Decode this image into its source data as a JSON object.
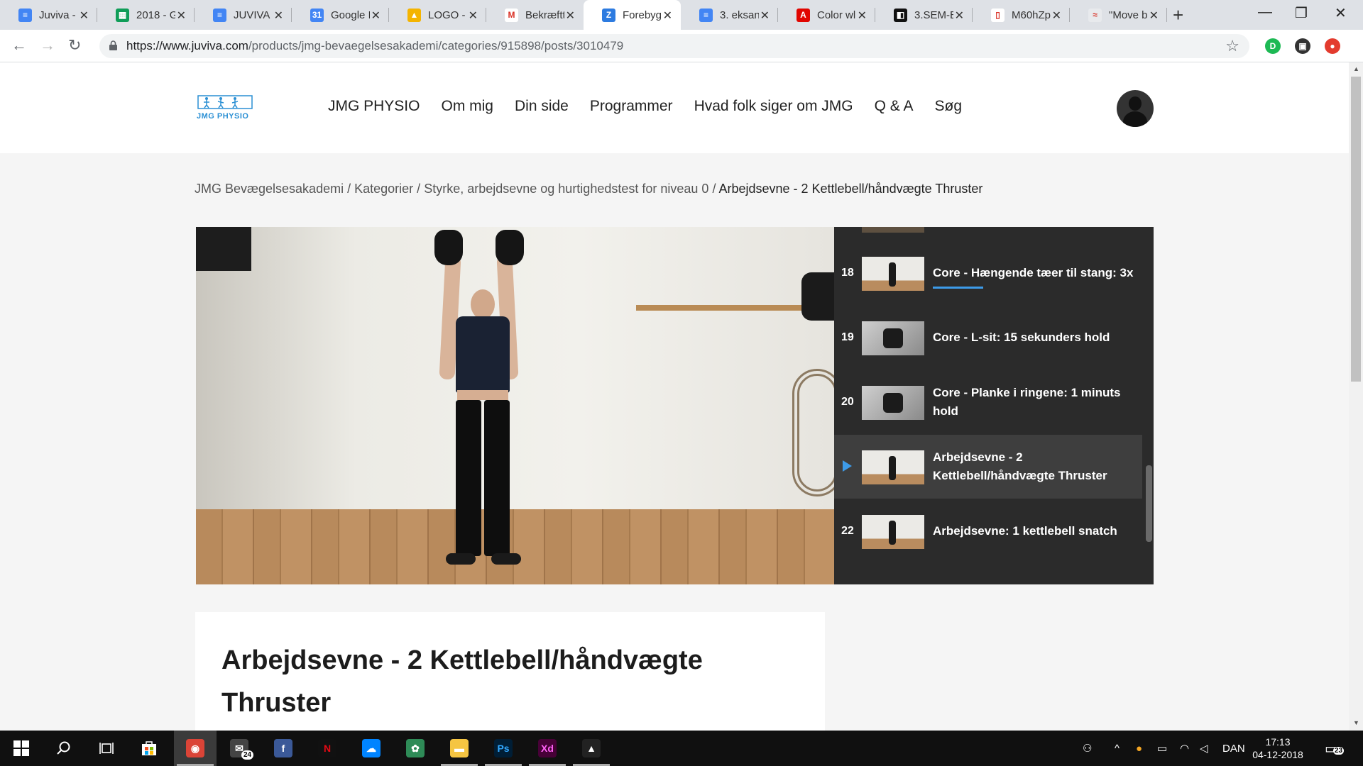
{
  "browser": {
    "tabs": [
      {
        "label": "Juviva - ",
        "color": "#4285f4",
        "glyph": "≡"
      },
      {
        "label": "2018 - G",
        "color": "#0f9d58",
        "glyph": "▦"
      },
      {
        "label": "JUVIVA ",
        "color": "#4285f4",
        "glyph": "≡"
      },
      {
        "label": "Google I",
        "color": "#4285f4",
        "glyph": "31"
      },
      {
        "label": "LOGO - ",
        "color": "#f4b400",
        "glyph": "▲"
      },
      {
        "label": "Bekræftt",
        "color": "#ffffff",
        "glyph": "M"
      },
      {
        "label": "Forebyg",
        "color": "#2d7be0",
        "glyph": "Z"
      },
      {
        "label": "3. eksan",
        "color": "#4285f4",
        "glyph": "≡"
      },
      {
        "label": "Color wl",
        "color": "#e10600",
        "glyph": "A"
      },
      {
        "label": "3.SEM-E",
        "color": "#111111",
        "glyph": "◧"
      },
      {
        "label": "M60hZp",
        "color": "#ffffff",
        "glyph": "▯"
      },
      {
        "label": "\"Move b",
        "color": "#e8eaed",
        "glyph": "≈"
      }
    ],
    "url_host": "https://www.juviva.com",
    "url_path": "/products/jmg-bevaegelsesakademi/categories/915898/posts/3010479",
    "new_tab_glyph": "+",
    "minimize_glyph": "—",
    "maximize_glyph": "❐",
    "close_glyph": "✕",
    "extensions": [
      {
        "glyph": "D",
        "color": "#1db954"
      },
      {
        "glyph": "▣",
        "color": "#333333"
      },
      {
        "glyph": "●",
        "color": "#e33b2e"
      }
    ]
  },
  "site": {
    "logo_text": "JMG PHYSIO",
    "nav": [
      "JMG PHYSIO",
      "Om mig",
      "Din side",
      "Programmer",
      "Hvad folk siger om JMG",
      "Q & A",
      "Søg"
    ]
  },
  "breadcrumb": {
    "crumbs": [
      "JMG Bevægelsesakademi",
      "Kategorier",
      "Styrke, arbejdsevne og hurtighedstest for niveau 0"
    ],
    "separator": " / ",
    "current": "Arbejdsevne - 2 Kettlebell/håndvægte Thruster"
  },
  "playlist": {
    "items": [
      {
        "num": "18",
        "title": "Core - Hængende tæer til stang: 3x",
        "thumb": "gym",
        "progress": 0.25,
        "active": false
      },
      {
        "num": "19",
        "title": "Core - L-sit: 15 sekunders hold",
        "thumb": "watch",
        "active": false
      },
      {
        "num": "20",
        "title": "Core - Planke i ringene: 1 minuts hold",
        "thumb": "watch",
        "active": false
      },
      {
        "num": "",
        "title": "Arbejdsevne - 2 Kettlebell/håndvægte Thruster",
        "thumb": "gym",
        "active": true
      },
      {
        "num": "22",
        "title": "Arbejdsevne: 1 kettlebell snatch",
        "thumb": "gym",
        "active": false
      }
    ]
  },
  "post": {
    "title": "Arbejdsevne - 2 Kettlebell/håndvægte Thruster"
  },
  "taskbar": {
    "apps": [
      {
        "name": "chrome",
        "glyph": "◉",
        "color": "#db4437",
        "running": true,
        "active": true
      },
      {
        "name": "mail",
        "glyph": "✉",
        "color": "#444444",
        "running": false,
        "badge": "24"
      },
      {
        "name": "facebook",
        "glyph": "f",
        "color": "#3b5998",
        "running": false
      },
      {
        "name": "netflix",
        "glyph": "N",
        "color": "#111111",
        "running": false
      },
      {
        "name": "messenger",
        "glyph": "☁",
        "color": "#0084ff",
        "running": false
      },
      {
        "name": "app-green",
        "glyph": "✿",
        "color": "#2e8b57",
        "running": false
      },
      {
        "name": "file-explorer",
        "glyph": "▬",
        "color": "#f5c542",
        "running": true
      },
      {
        "name": "photoshop",
        "glyph": "Ps",
        "color": "#001e36",
        "running": true
      },
      {
        "name": "adobe-xd",
        "glyph": "Xd",
        "color": "#470137",
        "running": true
      },
      {
        "name": "photos",
        "glyph": "▲",
        "color": "#222222",
        "running": true
      }
    ],
    "language": "DAN",
    "time": "17:13",
    "date": "04-12-2018",
    "notifications": "23"
  }
}
